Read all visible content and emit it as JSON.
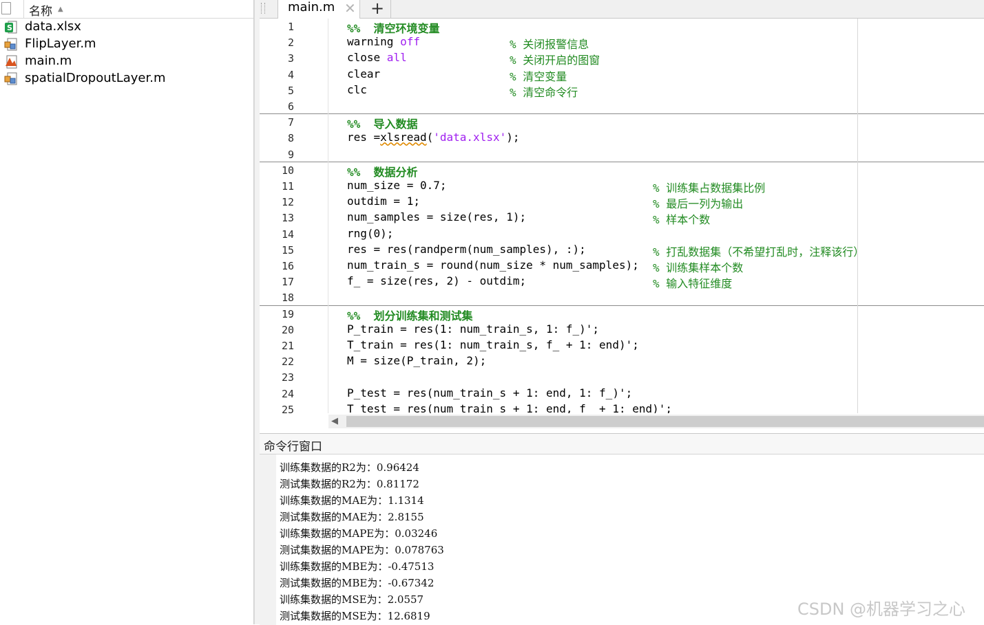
{
  "file_browser": {
    "header": "名称",
    "files": [
      {
        "name": "data.xlsx",
        "icon": "excel-file-icon"
      },
      {
        "name": "FlipLayer.m",
        "icon": "class-file-icon"
      },
      {
        "name": "main.m",
        "icon": "script-file-icon"
      },
      {
        "name": "spatialDropoutLayer.m",
        "icon": "class-file-icon"
      }
    ]
  },
  "editor": {
    "tab_label": "main.m",
    "tab_close": "✕",
    "tab_add": "+",
    "lines": [
      {
        "n": "1",
        "code": "",
        "section": "%%  清空环境变量",
        "comment": "",
        "cpos": ""
      },
      {
        "n": "2",
        "code": "warning ",
        "kw": "off",
        "comment": "% 关闭报警信息",
        "cpos": "c1"
      },
      {
        "n": "3",
        "code": "close ",
        "kw": "all",
        "comment": "% 关闭开启的图窗",
        "cpos": "c1"
      },
      {
        "n": "4",
        "code": "clear",
        "comment": "% 清空变量",
        "cpos": "c1"
      },
      {
        "n": "5",
        "code": "clc",
        "comment": "% 清空命令行",
        "cpos": "c1"
      },
      {
        "n": "6",
        "code": "",
        "comment": "",
        "cpos": ""
      },
      {
        "n": "7",
        "code": "",
        "section": "%%  导入数据",
        "comment": "",
        "cpos": ""
      },
      {
        "n": "8",
        "code_a": "res =",
        "code_wavy": "xlsread",
        "code_b": "(",
        "str": "'data.xlsx'",
        "code_c": ");",
        "comment": "",
        "cpos": ""
      },
      {
        "n": "9",
        "code": "",
        "comment": "",
        "cpos": ""
      },
      {
        "n": "10",
        "code": "",
        "section": "%%  数据分析",
        "comment": "",
        "cpos": ""
      },
      {
        "n": "11",
        "code": "num_size = 0.7;",
        "comment": "% 训练集占数据集比例",
        "cpos": "c2"
      },
      {
        "n": "12",
        "code": "outdim = 1;",
        "comment": "% 最后一列为输出",
        "cpos": "c2"
      },
      {
        "n": "13",
        "code": "num_samples = size(res, 1);",
        "comment": "% 样本个数",
        "cpos": "c2"
      },
      {
        "n": "14",
        "code": "rng(0);",
        "comment": "",
        "cpos": ""
      },
      {
        "n": "15",
        "code": "res = res(randperm(num_samples), :);",
        "comment": "% 打乱数据集（不希望打乱时，注释该行）",
        "cpos": "c2"
      },
      {
        "n": "16",
        "code": "num_train_s = round(num_size * num_samples);",
        "comment": "% 训练集样本个数",
        "cpos": "c2"
      },
      {
        "n": "17",
        "code": "f_ = size(res, 2) - outdim;",
        "comment": "% 输入特征维度",
        "cpos": "c2"
      },
      {
        "n": "18",
        "code": "",
        "comment": "",
        "cpos": ""
      },
      {
        "n": "19",
        "code": "",
        "section": "%%  划分训练集和测试集",
        "comment": "",
        "cpos": ""
      },
      {
        "n": "20",
        "code": "P_train = res(1: num_train_s, 1: f_)';",
        "comment": "",
        "cpos": ""
      },
      {
        "n": "21",
        "code": "T_train = res(1: num_train_s, f_ + 1: end)';",
        "comment": "",
        "cpos": ""
      },
      {
        "n": "22",
        "code": "M = size(P_train, 2);",
        "comment": "",
        "cpos": ""
      },
      {
        "n": "23",
        "code": "",
        "comment": "",
        "cpos": ""
      },
      {
        "n": "24",
        "code": "P_test = res(num_train_s + 1: end, 1: f_)';",
        "comment": "",
        "cpos": ""
      },
      {
        "n": "25",
        "code": "T_test = res(num_train_s + 1: end, f_ + 1: end)';",
        "comment": "",
        "cpos": ""
      }
    ]
  },
  "command_window": {
    "title": "命令行窗口",
    "output": [
      "训练集数据的R2为：0.96424",
      "测试集数据的R2为：0.81172",
      "训练集数据的MAE为：1.1314",
      "测试集数据的MAE为：2.8155",
      "训练集数据的MAPE为：0.03246",
      "测试集数据的MAPE为：0.078763",
      "训练集数据的MBE为：-0.47513",
      "测试集数据的MBE为：-0.67342",
      "训练集数据的MSE为：2.0557",
      "测试集数据的MSE为：12.6819"
    ]
  },
  "watermark": "CSDN @机器学习之心"
}
